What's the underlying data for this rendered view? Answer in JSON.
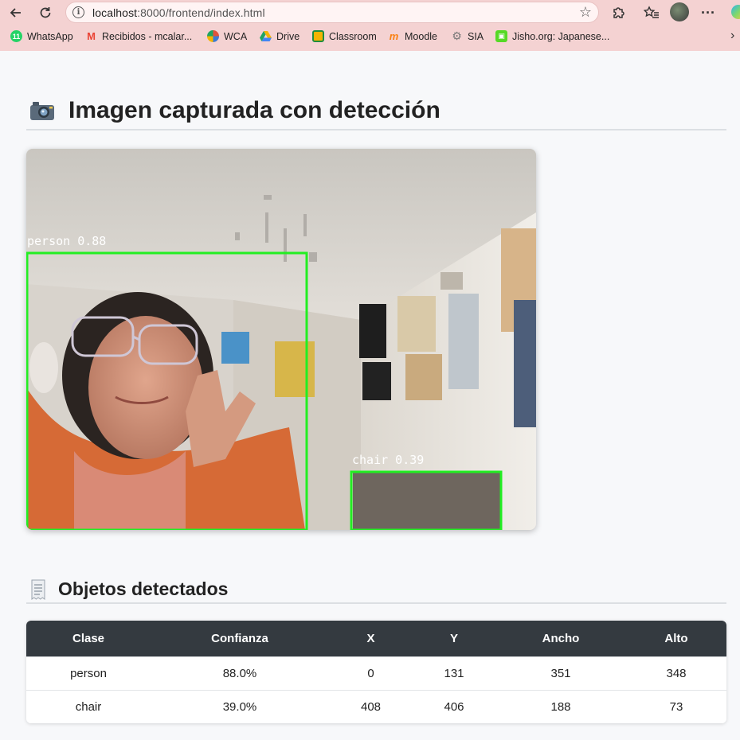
{
  "browser": {
    "url_host": "localhost",
    "url_path": ":8000/frontend/index.html",
    "bookmarks": [
      {
        "label": "WhatsApp",
        "icon": "whatsapp-icon",
        "color": "#25d366"
      },
      {
        "label": "Recibidos - mcalar...",
        "icon": "gmail-icon",
        "color": "#ea4335"
      },
      {
        "label": "WCA",
        "icon": "wca-icon",
        "color": "#e0533c"
      },
      {
        "label": "Drive",
        "icon": "drive-icon",
        "color": "#1fa463"
      },
      {
        "label": "Classroom",
        "icon": "classroom-icon",
        "color": "#f4b400"
      },
      {
        "label": "Moodle",
        "icon": "moodle-icon",
        "color": "#f98012"
      },
      {
        "label": "SIA",
        "icon": "sia-icon",
        "color": "#888888"
      },
      {
        "label": "Jisho.org: Japanese...",
        "icon": "jisho-icon",
        "color": "#56d926"
      }
    ]
  },
  "page": {
    "main_title": "Imagen capturada con detección",
    "table_title": "Objetos detectados"
  },
  "image": {
    "width": 640,
    "height": 479,
    "detections": [
      {
        "label": "person 0.88"
      },
      {
        "label": "chair 0.39"
      }
    ]
  },
  "table": {
    "headers": [
      "Clase",
      "Confianza",
      "X",
      "Y",
      "Ancho",
      "Alto"
    ],
    "rows": [
      [
        "person",
        "88.0%",
        "0",
        "131",
        "351",
        "348"
      ],
      [
        "chair",
        "39.0%",
        "408",
        "406",
        "188",
        "73"
      ]
    ]
  },
  "colors": {
    "box": "#22ee22",
    "table_header_bg": "#343a40",
    "chrome_bg": "#f4d2d2"
  }
}
